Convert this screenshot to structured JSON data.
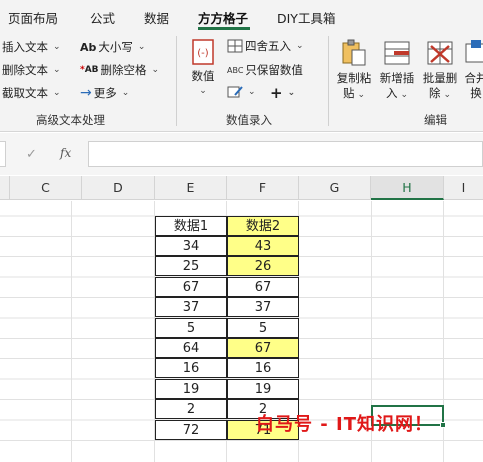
{
  "menu": {
    "tabs": [
      "页面布局",
      "公式",
      "数据",
      "方方格子",
      "DIY工具箱"
    ],
    "active": "方方格子"
  },
  "ribbon": {
    "text_group": {
      "insert_text": "插入文本",
      "delete_text": "删除文本",
      "extract_text": "截取文本",
      "case": "大小写",
      "delete_space": "删除空格",
      "more": "更多",
      "group_label": "高级文本处理"
    },
    "data_group": {
      "value_btn": "数值",
      "round": "四舍五入",
      "keep_values": "只保留数值",
      "group_label": "数值录入"
    },
    "edit_group": {
      "copy_paste_1": "复制粘",
      "copy_paste_2": "贴",
      "add_insert_1": "新增插",
      "add_insert_2": "入",
      "batch_delete_1": "批量删",
      "batch_delete_2": "除",
      "merge_1": "合并",
      "merge_2": "换",
      "group_label": "编辑"
    }
  },
  "formula_bar": {
    "fx": "fx",
    "content": ""
  },
  "columns": [
    "C",
    "D",
    "E",
    "F",
    "G",
    "H",
    "I"
  ],
  "selected_column": "H",
  "table": {
    "header": [
      "数据1",
      "数据2"
    ],
    "rows": [
      {
        "a": "34",
        "b": "43",
        "hl": true
      },
      {
        "a": "25",
        "b": "26",
        "hl": true
      },
      {
        "a": "67",
        "b": "67",
        "hl": false
      },
      {
        "a": "37",
        "b": "37",
        "hl": false
      },
      {
        "a": "5",
        "b": "5",
        "hl": false
      },
      {
        "a": "64",
        "b": "67",
        "hl": true
      },
      {
        "a": "16",
        "b": "16",
        "hl": false
      },
      {
        "a": "19",
        "b": "19",
        "hl": false
      },
      {
        "a": "2",
        "b": "2",
        "hl": false
      },
      {
        "a": "72",
        "b": "71",
        "hl": true
      }
    ]
  },
  "watermark": "白马号 - IT知识网！",
  "colors": {
    "accent": "#217346",
    "highlight": "#ffff88",
    "watermark": "#e01818"
  }
}
